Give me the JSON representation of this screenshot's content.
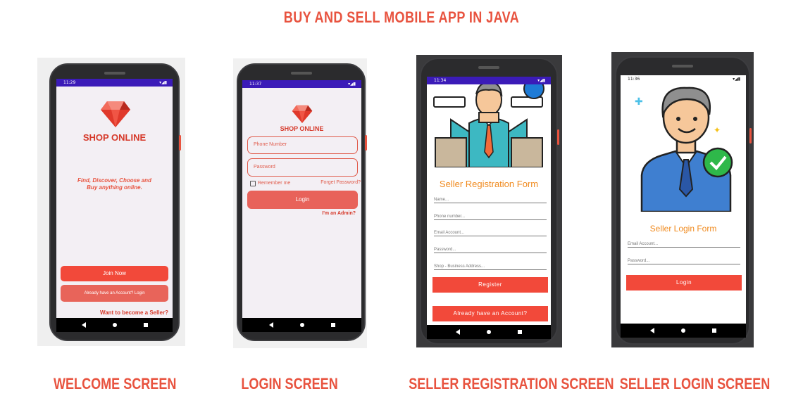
{
  "page_title": "BUY AND SELL MOBILE APP IN JAVA",
  "captions": [
    "WELCOME SCREEN",
    "LOGIN SCREEN",
    "SELLER REGISTRATION SCREEN",
    "SELLER LOGIN SCREEN"
  ],
  "colors": {
    "accent": "#e8533f",
    "status_bar": "#3b1bb8",
    "button_red": "#f2493a",
    "form_title": "#f08a1e"
  },
  "welcome": {
    "time": "11:29",
    "logo_text": "SHOP ONLINE",
    "tagline_1": "Find, Discover, Choose and",
    "tagline_2": "Buy anything online.",
    "join_button": "Join Now",
    "login_button": "Already have an Account? Login",
    "seller_link": "Want to become a Seller?"
  },
  "login": {
    "time": "11:37",
    "logo_text": "SHOP ONLINE",
    "phone_placeholder": "Phone Number",
    "password_placeholder": "Password",
    "remember_label": "Remember me",
    "forget_link": "Forget Password?",
    "login_button": "Login",
    "admin_link": "I'm an Admin?"
  },
  "seller_registration": {
    "time": "11:34",
    "title": "Seller Registration Form",
    "fields": [
      "Name...",
      "Phone number...",
      "Email Account...",
      "Password...",
      "Shop - Business Address..."
    ],
    "register_button": "Register",
    "account_button": "Already have an Account?"
  },
  "seller_login": {
    "time": "11:36",
    "title": "Seller Login Form",
    "fields": [
      "Email Account...",
      "Password..."
    ],
    "login_button": "Login"
  }
}
